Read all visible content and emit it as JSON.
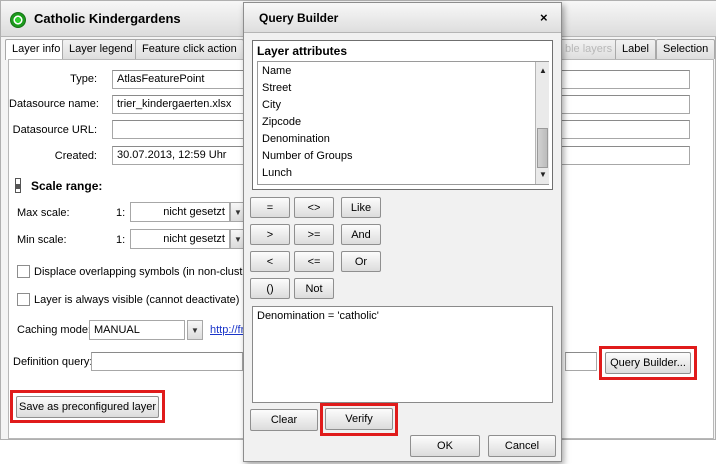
{
  "main": {
    "title": "Catholic Kindergardens",
    "tabs": [
      "Layer info",
      "Layer legend",
      "Feature click action",
      "ble layers",
      "Label",
      "Selection"
    ],
    "form": {
      "type_label": "Type:",
      "type_value": "AtlasFeaturePoint",
      "datasource_name_label": "Datasource name:",
      "datasource_name_value": "trier_kindergaerten.xlsx",
      "datasource_url_label": "Datasource URL:",
      "datasource_url_value": "",
      "created_label": "Created:",
      "created_value": "30.07.2013, 12:59 Uhr"
    },
    "scale": {
      "heading": "Scale range:",
      "max_label": "Max scale:",
      "min_label": "Min scale:",
      "prefix": "1:",
      "max_value": "nicht gesetzt",
      "min_value": "nicht gesetzt"
    },
    "options": {
      "displace_label": "Displace overlapping symbols (in non-cluster s",
      "always_visible_label": "Layer is always visible (cannot deactivate)"
    },
    "caching": {
      "label": "Caching mode:",
      "value": "MANUAL",
      "link": "http://fr"
    },
    "definition": {
      "label": "Definition query:",
      "value": "",
      "query_builder_button": "Query Builder..."
    },
    "save_button": "Save as preconfigured layer"
  },
  "dialog": {
    "title": "Query Builder",
    "close": "×",
    "attributes_heading": "Layer attributes",
    "attributes": [
      "Name",
      "Street",
      "City",
      "Zipcode",
      "Denomination",
      "Number of Groups",
      "Lunch"
    ],
    "operators": [
      [
        "=",
        "<>",
        "Like"
      ],
      [
        ">",
        ">=",
        "And"
      ],
      [
        "<",
        "<=",
        "Or"
      ],
      [
        "()",
        "Not"
      ]
    ],
    "expression": "Denomination = 'catholic'",
    "clear_button": "Clear",
    "verify_button": "Verify",
    "ok_button": "OK",
    "cancel_button": "Cancel"
  },
  "colors": {
    "highlight": "#e01b1b",
    "status": "#2fcf2f",
    "link": "#1a35c9"
  }
}
